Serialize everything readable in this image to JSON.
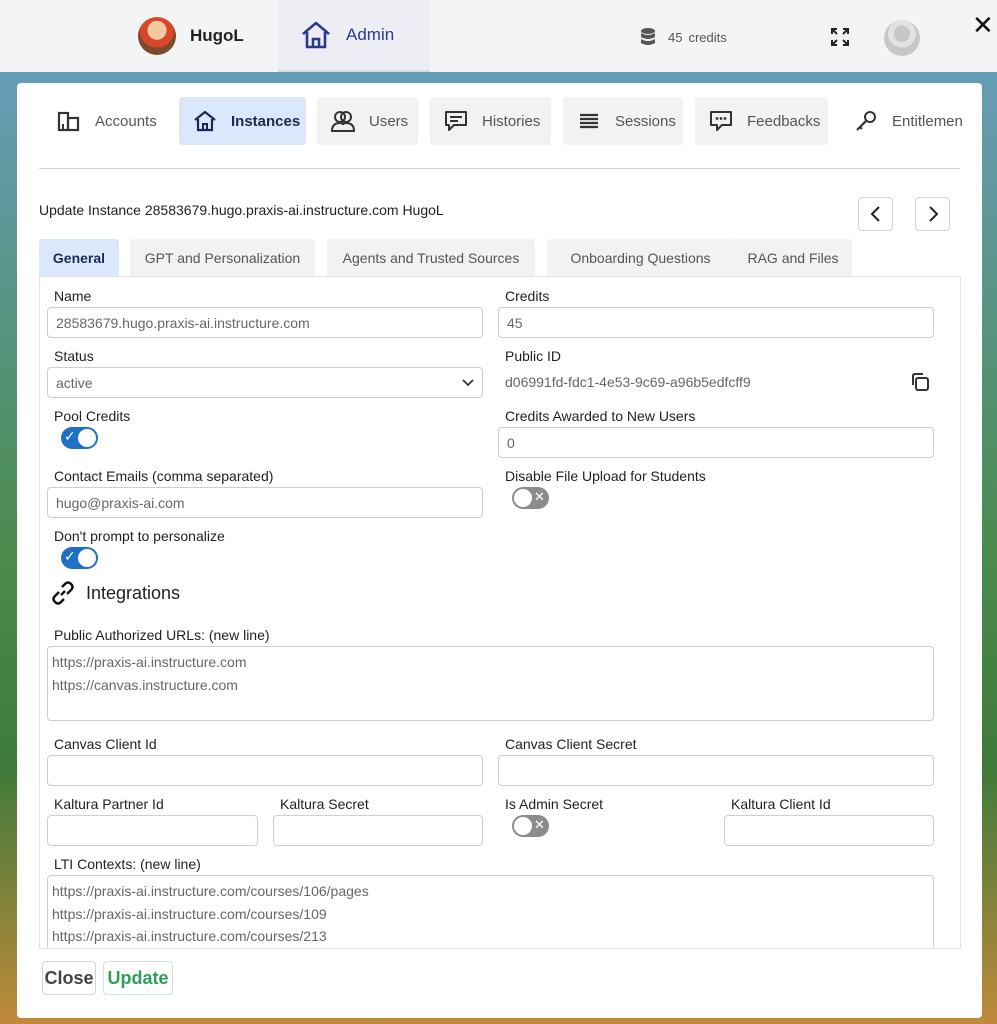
{
  "topbar": {
    "username": "HugoL",
    "admin_label": "Admin",
    "credits": "45",
    "credits_unit": "credits",
    "close_symbol": "✕"
  },
  "nav_tabs": [
    {
      "label": "Accounts",
      "icon": "building-icon",
      "active": false
    },
    {
      "label": "Instances",
      "icon": "home-icon",
      "active": true
    },
    {
      "label": "Users",
      "icon": "users-icon",
      "active": false
    },
    {
      "label": "Histories",
      "icon": "chat-lines-icon",
      "active": false
    },
    {
      "label": "Sessions",
      "icon": "list-icon",
      "active": false
    },
    {
      "label": "Feedbacks",
      "icon": "feedback-icon",
      "active": false
    },
    {
      "label": "Entitlemen",
      "icon": "key-icon",
      "active": false
    }
  ],
  "form": {
    "title": "Update Instance 28583679.hugo.praxis-ai.instructure.com HugoL",
    "subtabs": [
      "General",
      "GPT and Personalization",
      "Agents and Trusted Sources",
      "Onboarding Questions",
      "RAG and Files"
    ],
    "name_label": "Name",
    "name_value": "28583679.hugo.praxis-ai.instructure.com",
    "credits_label": "Credits",
    "credits_value": "45",
    "status_label": "Status",
    "status_value": "active",
    "public_id_label": "Public ID",
    "public_id_value": "d06991fd-fdc1-4e53-9c69-a96b5edfcff9",
    "pool_credits_label": "Pool Credits",
    "pool_credits_on": true,
    "credits_awarded_label": "Credits Awarded to New Users",
    "credits_awarded_value": "0",
    "contact_emails_label": "Contact Emails (comma separated)",
    "contact_emails_value": "hugo@praxis-ai.com",
    "disable_upload_label": "Disable File Upload for Students",
    "disable_upload_on": false,
    "dont_prompt_label": "Don't prompt to personalize",
    "dont_prompt_on": true,
    "integrations_heading": "Integrations",
    "public_urls_label": "Public Authorized URLs: (new line)",
    "public_urls": [
      "https://praxis-ai.instructure.com",
      "https://canvas.instructure.com"
    ],
    "canvas_client_id_label": "Canvas Client Id",
    "canvas_client_id_value": "",
    "canvas_client_secret_label": "Canvas Client Secret",
    "canvas_client_secret_value": "",
    "kaltura_partner_label": "Kaltura Partner Id",
    "kaltura_partner_value": "",
    "kaltura_secret_label": "Kaltura Secret",
    "kaltura_secret_value": "",
    "is_admin_secret_label": "Is Admin Secret",
    "is_admin_secret_on": false,
    "kaltura_client_label": "Kaltura Client Id",
    "kaltura_client_value": "",
    "lti_label": "LTI Contexts: (new line)",
    "lti_contexts": [
      "https://praxis-ai.instructure.com/courses/106/pages",
      "https://praxis-ai.instructure.com/courses/109",
      "https://praxis-ai.instructure.com/courses/213"
    ],
    "toggle_on_mark": "✓",
    "toggle_off_mark": "✕"
  },
  "footer": {
    "close_label": "Close",
    "update_label": "Update"
  },
  "colors": {
    "accent": "#1f6fc4",
    "active_tab": "#dbe8fb",
    "update_green": "#2e9e5b"
  }
}
